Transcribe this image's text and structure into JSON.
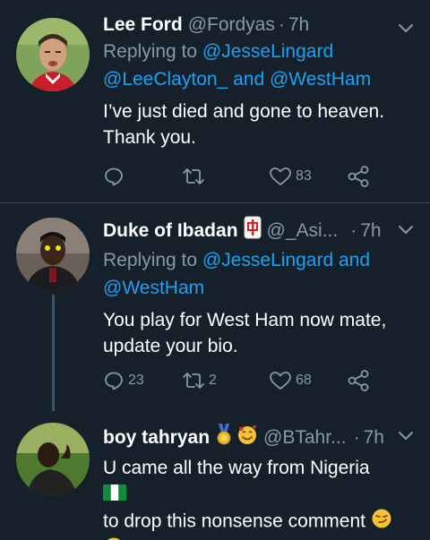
{
  "tweets": [
    {
      "name": "Lee Ford",
      "handle": "@Fordyas",
      "separator": "·",
      "time": "7h",
      "reply_prefix": "Replying to",
      "reply_mention1": "@JesseLingard",
      "reply_mention2": "@LeeClayton_",
      "reply_and": "and",
      "reply_mention3": "@WestHam",
      "text_line1": "I’ve just died and gone to heaven.",
      "text_line2": "Thank you.",
      "replies": "",
      "retweets": "",
      "likes": "83",
      "avatar_icon": "player-avatar-icon"
    },
    {
      "name": "Duke of Ibadan",
      "name_emoji": "mahjong-tile-icon",
      "handle": "@_Asi...",
      "separator": "·",
      "time": "7h",
      "reply_prefix": "Replying to",
      "reply_mention1": "@JesseLingard",
      "reply_and": "and",
      "reply_mention2": "@WestHam",
      "text_line1": "You play for West Ham now mate,",
      "text_line2": "update your bio.",
      "replies": "23",
      "retweets": "2",
      "likes": "68",
      "avatar_icon": "person-avatar-icon"
    },
    {
      "name": "boy tahryan",
      "handle": "@BTahr...",
      "separator": "·",
      "time": "7h",
      "text_line1": "U came all the way from Nigeria",
      "text_line2": "to drop this nonsense comment",
      "emojis": [
        "medal-icon",
        "smiling-face-with-hearts-icon",
        "nigeria-flag-icon",
        "smirking-face-icon",
        "unamused-face-icon"
      ],
      "avatar_icon": "person-avatar-icon"
    }
  ],
  "colors": {
    "background": "#15202b",
    "divider": "#38444d",
    "secondary_text": "#8899a6",
    "link": "#1da1f2",
    "thread_line": "#3d5466"
  }
}
